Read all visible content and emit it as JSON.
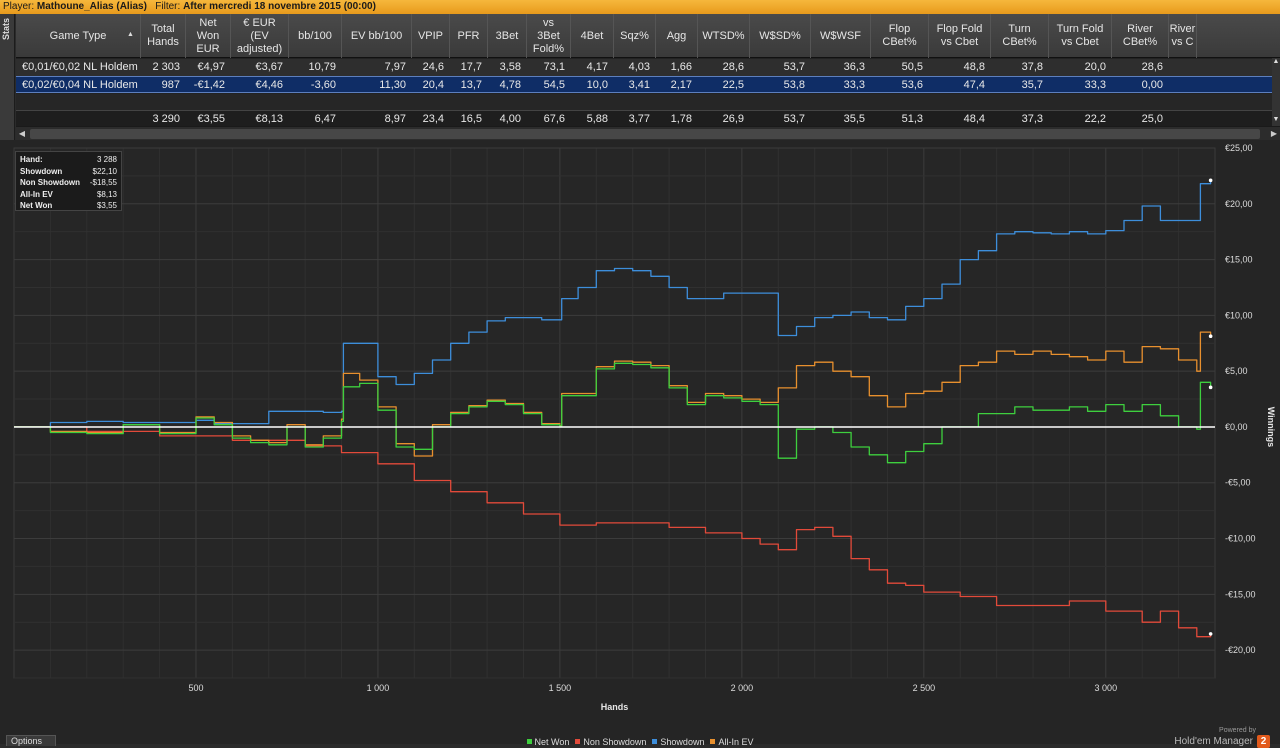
{
  "header": {
    "player_label": "Player:",
    "player_name": "Mathoune_Alias (Alias)",
    "filter_label": "Filter:",
    "filter_value": "After mercredi 18 novembre 2015 (00:00)"
  },
  "side_tab": "Stats",
  "table": {
    "columns": [
      {
        "label": "Game Type",
        "sort": "▲"
      },
      {
        "label": "Total\nHands"
      },
      {
        "label": "Net\nWon\nEUR"
      },
      {
        "label": "€ EUR\n(EV\nadjusted)"
      },
      {
        "label": "bb/100"
      },
      {
        "label": "EV bb/100"
      },
      {
        "label": "VPIP"
      },
      {
        "label": "PFR"
      },
      {
        "label": "3Bet"
      },
      {
        "label": "vs\n3Bet\nFold%"
      },
      {
        "label": "4Bet"
      },
      {
        "label": "Sqz%"
      },
      {
        "label": "Agg"
      },
      {
        "label": "WTSD%"
      },
      {
        "label": "W$SD%"
      },
      {
        "label": "W$WSF"
      },
      {
        "label": "Flop\nCBet%"
      },
      {
        "label": "Flop Fold\nvs Cbet"
      },
      {
        "label": "Turn\nCBet%"
      },
      {
        "label": "Turn Fold\nvs Cbet"
      },
      {
        "label": "River\nCBet%"
      },
      {
        "label": "River\nvs C"
      }
    ],
    "rows": [
      [
        "€0,01/€0,02 NL Holdem",
        "2 303",
        "€4,97",
        "€3,67",
        "10,79",
        "7,97",
        "24,6",
        "17,7",
        "3,58",
        "73,1",
        "4,17",
        "4,03",
        "1,66",
        "28,6",
        "53,7",
        "36,3",
        "50,5",
        "48,8",
        "37,8",
        "20,0",
        "28,6",
        ""
      ],
      [
        "€0,02/€0,04 NL Holdem",
        "987",
        "-€1,42",
        "€4,46",
        "-3,60",
        "11,30",
        "20,4",
        "13,7",
        "4,78",
        "54,5",
        "10,0",
        "3,41",
        "2,17",
        "22,5",
        "53,8",
        "33,3",
        "53,6",
        "47,4",
        "35,7",
        "33,3",
        "0,00",
        ""
      ]
    ],
    "totals": [
      "",
      "3 290",
      "€3,55",
      "€8,13",
      "6,47",
      "8,97",
      "23,4",
      "16,5",
      "4,00",
      "67,6",
      "5,88",
      "3,77",
      "1,78",
      "26,9",
      "53,7",
      "35,5",
      "51,3",
      "48,4",
      "37,3",
      "22,2",
      "25,0",
      ""
    ]
  },
  "summary": {
    "hand_label": "Hand:",
    "hand_value": "3 288",
    "showdown_label": "Showdown",
    "showdown_value": "$22,10",
    "nonshowdown_label": "Non Showdown",
    "nonshowdown_value": "-$18,55",
    "allin_label": "All-In EV",
    "allin_value": "$8,13",
    "netwon_label": "Net Won",
    "netwon_value": "$3,55"
  },
  "chart_data": {
    "type": "line",
    "xlabel": "Hands",
    "ylabel": "Winnings",
    "xlim": [
      0,
      3300
    ],
    "ylim": [
      -22.5,
      25
    ],
    "x_ticks": [
      500,
      1000,
      1500,
      2000,
      2500,
      3000
    ],
    "x_tick_labels": [
      "500",
      "1 000",
      "1 500",
      "2 000",
      "2 500",
      "3 000"
    ],
    "y_ticks": [
      -20,
      -15,
      -10,
      -5,
      0,
      5,
      10,
      15,
      20,
      25
    ],
    "y_tick_labels": [
      "-€20,00",
      "-€15,00",
      "-€10,00",
      "-€5,00",
      "€0,00",
      "€5,00",
      "€10,00",
      "€15,00",
      "€20,00",
      "€25,00"
    ],
    "grid": true,
    "legend_position": "bottom",
    "series": [
      {
        "name": "Net Won",
        "color": "#3ecf3e",
        "x": [
          0,
          100,
          200,
          300,
          400,
          500,
          550,
          600,
          650,
          700,
          750,
          800,
          850,
          900,
          905,
          950,
          1000,
          1050,
          1100,
          1150,
          1200,
          1250,
          1300,
          1350,
          1400,
          1450,
          1500,
          1505,
          1550,
          1600,
          1650,
          1700,
          1750,
          1800,
          1850,
          1900,
          1950,
          2000,
          2050,
          2095,
          2100,
          2150,
          2200,
          2250,
          2300,
          2350,
          2400,
          2450,
          2500,
          2550,
          2600,
          2650,
          2700,
          2750,
          2800,
          2850,
          2900,
          2950,
          3000,
          3050,
          3100,
          3150,
          3200,
          3250,
          3260,
          3288
        ],
        "y": [
          0,
          -0.5,
          -0.6,
          0.2,
          -0.6,
          0.8,
          0.2,
          -1.0,
          -1.4,
          -1.6,
          0.0,
          -1.8,
          -1.0,
          0.5,
          3.6,
          3.9,
          1.5,
          -1.8,
          -2.0,
          0.0,
          1.2,
          1.8,
          2.3,
          2.0,
          1.2,
          0.2,
          0.0,
          2.8,
          2.8,
          5.2,
          5.7,
          5.6,
          5.3,
          3.5,
          2.0,
          2.8,
          2.6,
          2.3,
          2.0,
          2.0,
          -2.8,
          -0.2,
          0.0,
          -0.5,
          -1.8,
          -2.5,
          -3.2,
          -2.2,
          -1.5,
          0.0,
          0.0,
          1.2,
          1.2,
          1.8,
          1.5,
          1.5,
          1.8,
          1.4,
          2.0,
          1.4,
          2.0,
          1.0,
          0.0,
          -0.2,
          4.0,
          3.55
        ]
      },
      {
        "name": "Non Showdown",
        "color": "#e24a3a",
        "x": [
          0,
          200,
          400,
          600,
          800,
          900,
          1000,
          1100,
          1200,
          1300,
          1400,
          1500,
          1600,
          1700,
          1800,
          1900,
          2000,
          2050,
          2100,
          2150,
          2200,
          2250,
          2300,
          2350,
          2400,
          2450,
          2500,
          2600,
          2700,
          2800,
          2900,
          3000,
          3100,
          3150,
          3200,
          3250,
          3288
        ],
        "y": [
          0,
          -0.4,
          -0.8,
          -1.2,
          -1.7,
          -2.3,
          -3.3,
          -4.8,
          -5.8,
          -6.8,
          -7.8,
          -8.8,
          -8.6,
          -8.6,
          -9.0,
          -9.5,
          -10.0,
          -10.5,
          -11.0,
          -9.2,
          -9.0,
          -9.8,
          -11.8,
          -12.8,
          -14.0,
          -14.2,
          -14.8,
          -15.2,
          -16.0,
          -16.0,
          -15.6,
          -16.5,
          -17.5,
          -16.5,
          -18.0,
          -18.8,
          -18.55
        ]
      },
      {
        "name": "Showdown",
        "color": "#3d8edb",
        "x": [
          0,
          100,
          200,
          300,
          400,
          500,
          550,
          600,
          650,
          700,
          750,
          800,
          850,
          900,
          905,
          950,
          1000,
          1050,
          1100,
          1150,
          1200,
          1250,
          1300,
          1350,
          1400,
          1450,
          1500,
          1505,
          1550,
          1600,
          1650,
          1700,
          1750,
          1800,
          1850,
          1900,
          1950,
          2000,
          2050,
          2095,
          2100,
          2150,
          2200,
          2250,
          2300,
          2350,
          2400,
          2450,
          2500,
          2550,
          2600,
          2650,
          2700,
          2750,
          2800,
          2850,
          2900,
          2950,
          3000,
          3050,
          3100,
          3150,
          3200,
          3250,
          3260,
          3288
        ],
        "y": [
          0,
          0.4,
          0.5,
          0.4,
          0.4,
          0.6,
          0.3,
          0.3,
          0.3,
          1.4,
          1.4,
          1.4,
          1.3,
          1.4,
          7.5,
          7.5,
          4.5,
          3.8,
          4.8,
          6.0,
          7.5,
          8.5,
          9.5,
          9.8,
          9.8,
          9.6,
          9.6,
          11.5,
          12.5,
          14.0,
          14.2,
          14.0,
          13.5,
          12.5,
          11.5,
          11.5,
          12.0,
          12.0,
          12.0,
          12.0,
          8.2,
          9.0,
          9.8,
          10.0,
          10.3,
          9.8,
          9.6,
          10.8,
          11.5,
          12.8,
          15.0,
          15.8,
          17.3,
          17.5,
          17.4,
          17.3,
          17.5,
          17.3,
          17.6,
          18.5,
          19.8,
          18.5,
          18.5,
          18.5,
          21.8,
          22.1
        ]
      },
      {
        "name": "All-In EV",
        "color": "#e8902e",
        "x": [
          0,
          100,
          200,
          300,
          400,
          500,
          550,
          600,
          650,
          700,
          750,
          800,
          850,
          900,
          905,
          950,
          1000,
          1050,
          1100,
          1150,
          1200,
          1250,
          1300,
          1350,
          1400,
          1450,
          1500,
          1505,
          1550,
          1600,
          1650,
          1700,
          1750,
          1800,
          1850,
          1900,
          1950,
          2000,
          2050,
          2095,
          2100,
          2150,
          2200,
          2250,
          2300,
          2350,
          2400,
          2450,
          2500,
          2550,
          2600,
          2650,
          2700,
          2750,
          2800,
          2850,
          2900,
          2950,
          3000,
          3050,
          3100,
          3150,
          3200,
          3250,
          3260,
          3288
        ],
        "y": [
          0,
          -0.4,
          -0.5,
          0.2,
          -0.5,
          0.9,
          0.4,
          -0.8,
          -1.2,
          -1.4,
          0.2,
          -1.6,
          -0.8,
          0.7,
          4.8,
          4.2,
          1.8,
          -1.5,
          -2.6,
          0.2,
          1.3,
          1.9,
          2.4,
          2.1,
          1.3,
          0.3,
          0.1,
          3.0,
          3.0,
          5.4,
          5.9,
          5.8,
          5.5,
          3.7,
          2.2,
          3.0,
          2.8,
          2.5,
          2.2,
          2.2,
          3.5,
          5.5,
          5.8,
          5.0,
          4.5,
          2.8,
          1.8,
          3.0,
          3.2,
          4.0,
          5.5,
          5.8,
          6.8,
          6.5,
          6.8,
          6.5,
          6.3,
          6.0,
          6.8,
          5.8,
          7.2,
          7.0,
          6.0,
          5.0,
          8.5,
          8.13
        ]
      }
    ]
  },
  "footer": {
    "options_label": "Options",
    "powered_by": "Powered by",
    "brand_name": "Hold'em Manager",
    "brand_badge": "2"
  }
}
